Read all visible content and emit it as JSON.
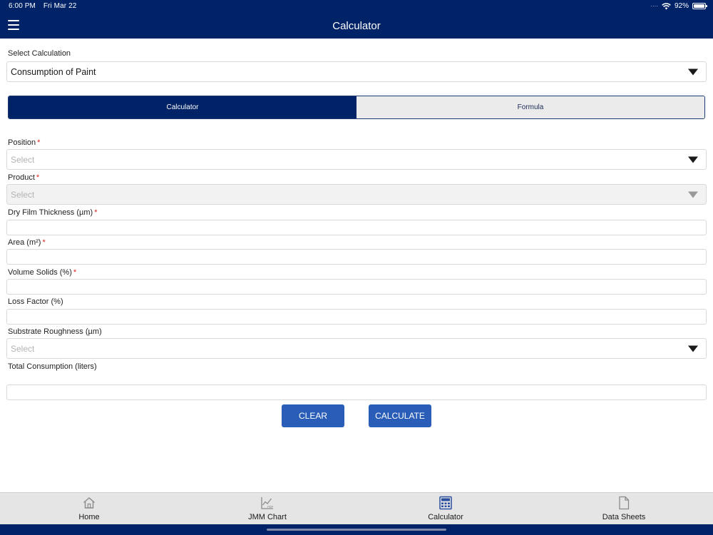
{
  "status_bar": {
    "time": "6:00 PM",
    "date": "Fri Mar 22",
    "battery": "92%",
    "battery_level": 0.92
  },
  "header": {
    "title": "Calculator",
    "menu_icon": "hamburger-icon"
  },
  "select_calculation": {
    "label": "Select Calculation",
    "value": "Consumption of Paint"
  },
  "tabs": [
    {
      "label": "Calculator",
      "active": true
    },
    {
      "label": "Formula",
      "active": false
    }
  ],
  "form": {
    "position": {
      "label": "Position",
      "required": "*",
      "placeholder": "Select"
    },
    "product": {
      "label": "Product",
      "required": "*",
      "placeholder": "Select"
    },
    "dry_film_thickness": {
      "label": "Dry Film Thickness (µm)",
      "required": "*",
      "value": ""
    },
    "area": {
      "label": "Area (m²)",
      "required": "*",
      "value": ""
    },
    "volume_solids": {
      "label": "Volume Solids (%)",
      "required": "*",
      "value": ""
    },
    "loss_factor": {
      "label": "Loss Factor (%)",
      "value": ""
    },
    "substrate_roughness": {
      "label": "Substrate Roughness (µm)",
      "placeholder": "Select"
    },
    "total_consumption": {
      "label": "Total Consumption (liters)",
      "value": ""
    }
  },
  "buttons": {
    "clear": "CLEAR",
    "calculate": "CALCULATE"
  },
  "bottom_nav": [
    {
      "label": "Home",
      "icon": "home-icon",
      "active": false
    },
    {
      "label": "JMM Chart",
      "icon": "chart-pdf-icon",
      "active": false
    },
    {
      "label": "Calculator",
      "icon": "calculator-icon",
      "active": true
    },
    {
      "label": "Data Sheets",
      "icon": "document-icon",
      "active": false
    }
  ],
  "colors": {
    "primary": "#002266",
    "button": "#2a5db8",
    "required": "#e02020",
    "active_nav": "#2a4f9e"
  }
}
